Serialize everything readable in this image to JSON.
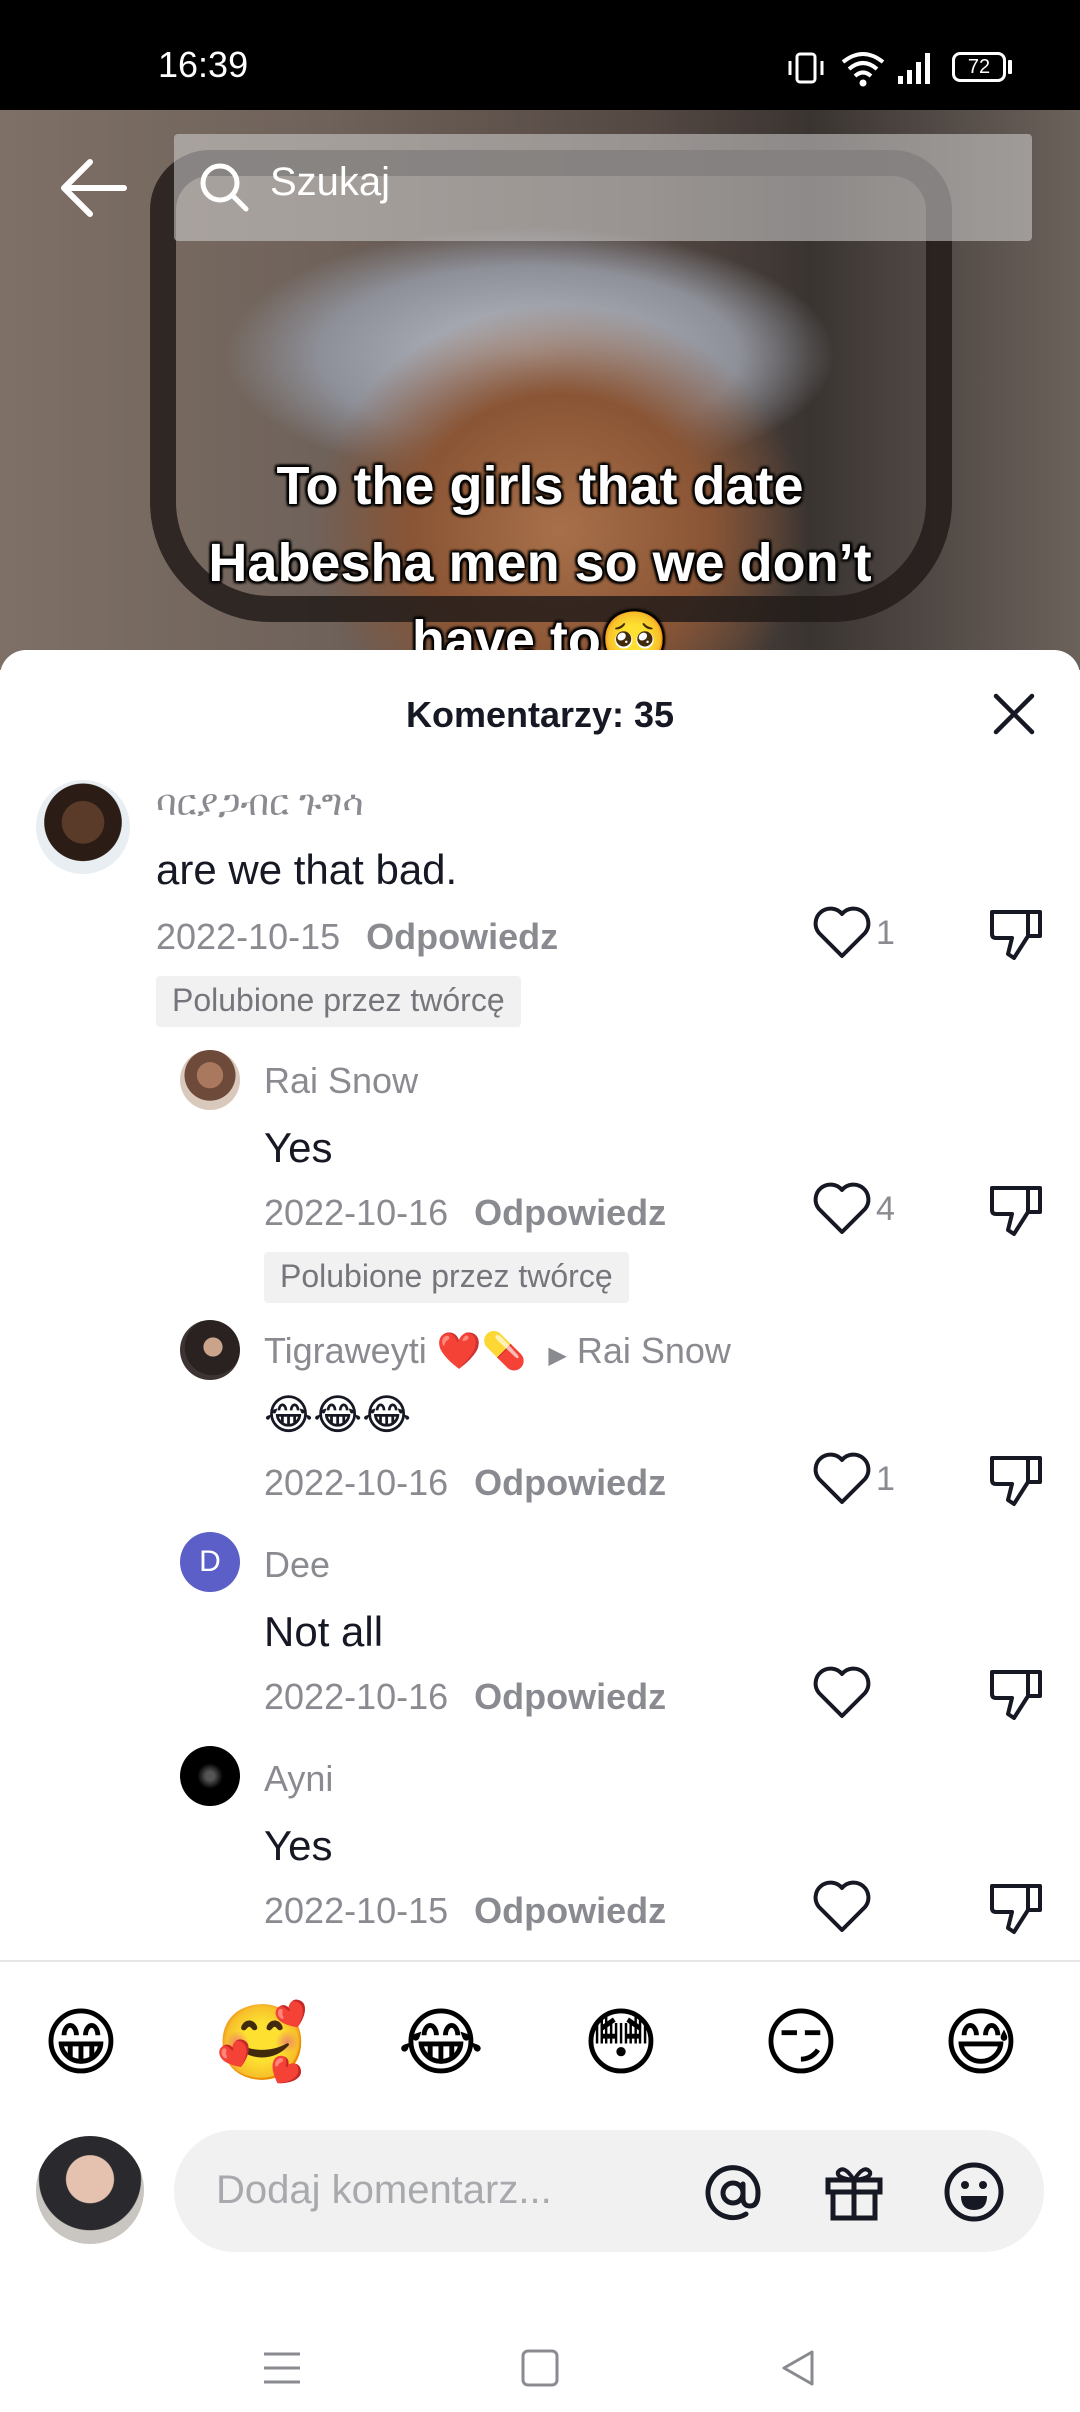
{
  "status_bar": {
    "time": "16:39",
    "battery": "72"
  },
  "video": {
    "caption_lines": [
      "To the girls that date",
      "Habesha men so we don’t",
      "have to🥺"
    ]
  },
  "search": {
    "placeholder": "Szukaj"
  },
  "comments_sheet": {
    "title": "Komentarzy: 35",
    "reply_label": "Odpowiedz",
    "creator_badge": "Polubione przez twórcę",
    "comments": [
      {
        "author": "ባርያጋብር ጉግሳ",
        "text": "are we that bad.",
        "date": "2022-10-15",
        "likes": "1",
        "creator_liked": true
      },
      {
        "author": "Rai Snow",
        "text": "Yes",
        "date": "2022-10-16",
        "likes": "4",
        "creator_liked": true
      },
      {
        "author": "Tigraweyti ❤️💊",
        "reply_to": "Rai Snow",
        "text": "😂😂😂",
        "date": "2022-10-16",
        "likes": "1"
      },
      {
        "author": "Dee",
        "avatar_letter": "D",
        "text": "Not all",
        "date": "2022-10-16",
        "likes": ""
      },
      {
        "author": "Ayni",
        "text": "Yes",
        "date": "2022-10-15",
        "likes": ""
      }
    ]
  },
  "quick_emojis": [
    "😁",
    "🥰",
    "😂",
    "😳",
    "😏",
    "😅"
  ],
  "comment_input": {
    "placeholder": "Dodaj komentarz..."
  },
  "colors": {
    "accent_avatar_dee": "#5b5fc7",
    "text_primary": "#161823",
    "text_secondary": "#8a8b91"
  }
}
